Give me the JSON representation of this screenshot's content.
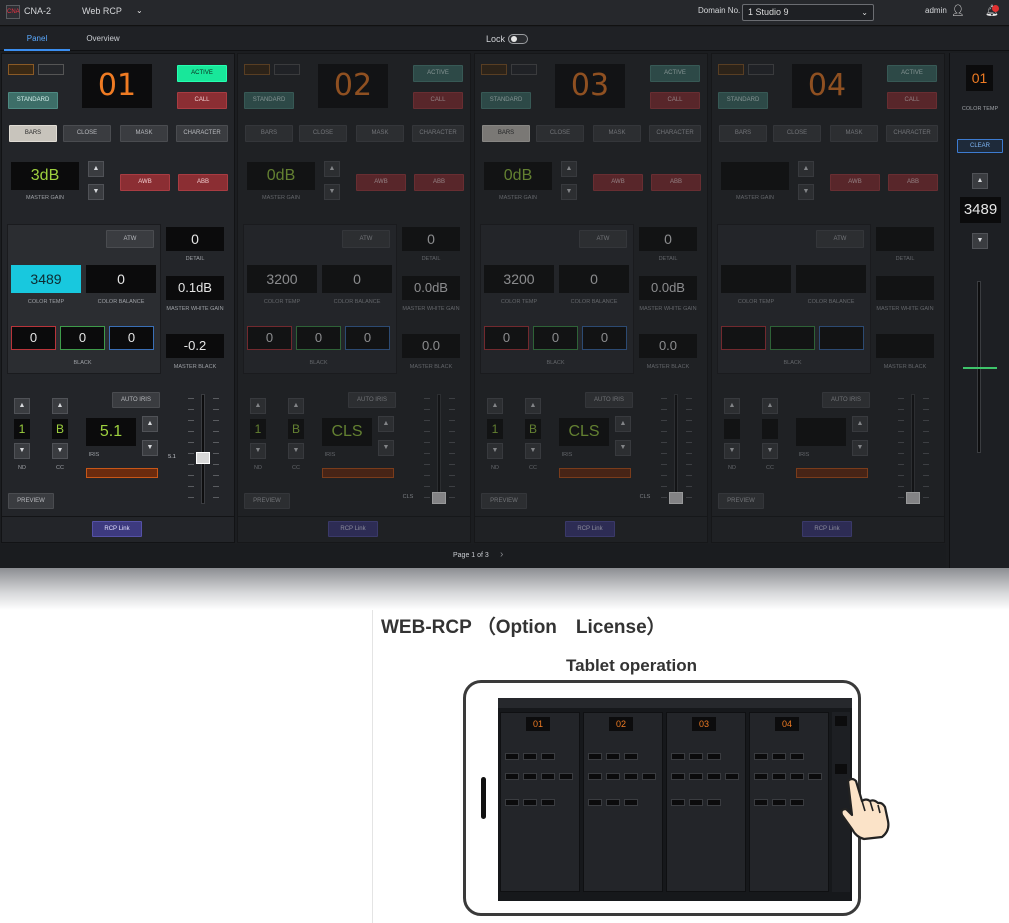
{
  "topbar": {
    "logo_text": "CNA",
    "app_name": "CNA-2",
    "page_selector": "Web RCP",
    "domain_label": "Domain No.",
    "domain_value": "1 Studio 9",
    "user": "admin",
    "icons": [
      "user-icon",
      "bell-icon"
    ]
  },
  "tabs": [
    {
      "label": "Panel",
      "active": true
    },
    {
      "label": "Overview",
      "active": false
    }
  ],
  "lock": {
    "label": "Lock",
    "on": false
  },
  "common_labels": {
    "standard": "STANDARD",
    "active": "ACTIVE",
    "call": "CALL",
    "bars": "BARS",
    "close": "CLOSE",
    "mask": "MASK",
    "character": "CHARACTER",
    "awb": "AWB",
    "abb": "ABB",
    "master_gain": "MASTER GAIN",
    "atw": "ATW",
    "detail": "DETAIL",
    "color_temp": "COLOR TEMP",
    "color_balance": "COLOR BALANCE",
    "master_white_gain": "MASTER WHITE GAIN",
    "black": "BLACK",
    "master_black": "MASTER BLACK",
    "auto_iris": "AUTO IRIS",
    "nd": "ND",
    "cc": "CC",
    "iris": "IRIS",
    "preview": "PREVIEW",
    "rcp_link": "RCP Link"
  },
  "panels": [
    {
      "number": "01",
      "master_gain": "3dB",
      "detail": "0",
      "color_temp": "3489",
      "color_balance": "0",
      "master_white_gain": "0.1dB",
      "black_r": "0",
      "black_g": "0",
      "black_b": "0",
      "master_black": "-0.2",
      "nd": "1",
      "cc": "B",
      "iris": "5.1",
      "fader_label": "5.1",
      "active": true
    },
    {
      "number": "02",
      "master_gain": "0dB",
      "detail": "0",
      "color_temp": "3200",
      "color_balance": "0",
      "master_white_gain": "0.0dB",
      "black_r": "0",
      "black_g": "0",
      "black_b": "0",
      "master_black": "0.0",
      "nd": "1",
      "cc": "B",
      "iris": "CLS",
      "fader_label": "CLS",
      "active": false
    },
    {
      "number": "03",
      "master_gain": "0dB",
      "detail": "0",
      "color_temp": "3200",
      "color_balance": "0",
      "master_white_gain": "0.0dB",
      "black_r": "0",
      "black_g": "0",
      "black_b": "0",
      "master_black": "0.0",
      "nd": "1",
      "cc": "B",
      "iris": "CLS",
      "fader_label": "CLS",
      "active": false
    },
    {
      "number": "04",
      "master_gain": "",
      "detail": "",
      "color_temp": "",
      "color_balance": "",
      "master_white_gain": "",
      "black_r": "",
      "black_g": "",
      "black_b": "",
      "master_black": "",
      "nd": "",
      "cc": "",
      "iris": "",
      "fader_label": "",
      "active": false
    }
  ],
  "side": {
    "number": "01",
    "label": "COLOR TEMP",
    "clear": "CLEAR",
    "value": "3489"
  },
  "pager": {
    "text": "Page 1 of 3",
    "next": "›"
  },
  "captions": {
    "title": "WEB-RCP （Option　License）",
    "subtitle": "Tablet operation"
  },
  "tablet": {
    "numbers": [
      "01",
      "02",
      "03",
      "04"
    ]
  }
}
